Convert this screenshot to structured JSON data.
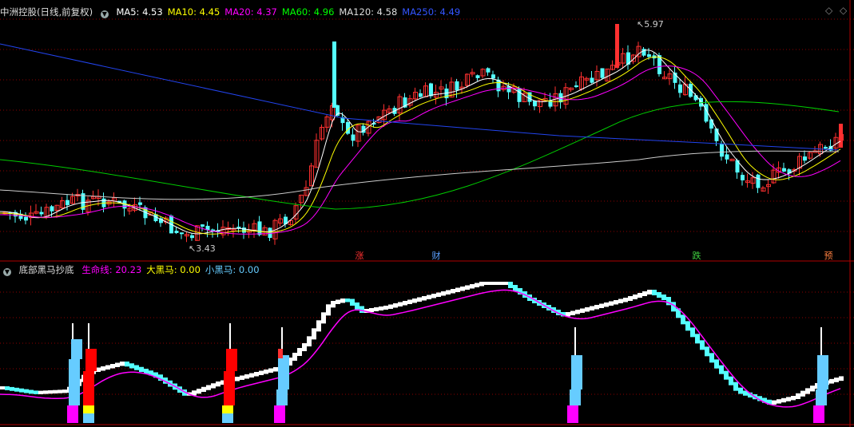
{
  "main_header": {
    "stock_name": "中洲控股(日线,前复权)",
    "indicators": [
      {
        "label": "MA5: 4.53",
        "color": "#ffffff"
      },
      {
        "label": "MA10: 4.45",
        "color": "#ffff00"
      },
      {
        "label": "MA20: 4.37",
        "color": "#ff00ff"
      },
      {
        "label": "MA60: 4.96",
        "color": "#00ff00"
      },
      {
        "label": "MA120: 4.58",
        "color": "#dddddd"
      },
      {
        "label": "MA250: 4.49",
        "color": "#3355ff"
      }
    ]
  },
  "price_annotations": {
    "high": "5.97",
    "low": "3.43"
  },
  "signals": [
    {
      "text": "涨",
      "color": "#ff3030"
    },
    {
      "text": "财",
      "color": "#5aa0ff"
    },
    {
      "text": "跌",
      "color": "#40d040"
    },
    {
      "text": "预",
      "color": "#ff8040"
    }
  ],
  "sub_header": {
    "name": "底部黑马抄底",
    "indicators": [
      {
        "label": "生命线: 20.23",
        "color": "#ff00ff"
      },
      {
        "label": "大黑马: 0.00",
        "color": "#ffff00"
      },
      {
        "label": "小黑马: 0.00",
        "color": "#66ccff"
      }
    ]
  },
  "top_icons": {
    "collapse": "◇",
    "expand": "◇"
  },
  "colors": {
    "up": "#ff3030",
    "down": "#54ffff",
    "bg": "#000000",
    "grid": "#8b0000"
  },
  "chart_data": {
    "type": "candlestick",
    "price_high": 5.97,
    "price_low": 3.43,
    "ma_values": {
      "MA5": 4.53,
      "MA10": 4.45,
      "MA20": 4.37,
      "MA60": 4.96,
      "MA120": 4.58,
      "MA250": 4.49
    },
    "sub_values": {
      "生命线": 20.23,
      "大黑马": 0.0,
      "小黑马": 0.0
    }
  }
}
